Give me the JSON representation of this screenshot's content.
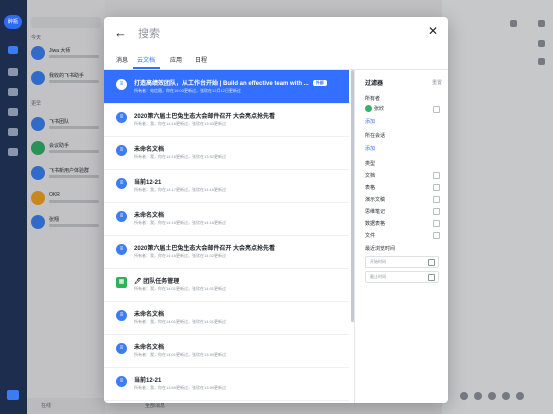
{
  "sidebar": {
    "avatar_label": "醉瓶"
  },
  "chat_list": {
    "search_placeholder": "搜索",
    "section_today": "今天",
    "section_earlier": "更早",
    "rows": [
      {
        "name": "Jiwa 大师"
      },
      {
        "name": "我收的飞书助手"
      },
      {
        "name": "飞书团队"
      },
      {
        "name": "会议助手"
      },
      {
        "name": "飞书新用户体验群"
      },
      {
        "name": "OKR"
      },
      {
        "name": "张翔"
      }
    ],
    "bottom_label": "在线"
  },
  "search_modal": {
    "back_icon": "arrow-left-icon",
    "close_icon": "close-icon",
    "placeholder": "搜索",
    "tabs": [
      {
        "label": "消息"
      },
      {
        "label": "云文档"
      },
      {
        "label": "应用"
      },
      {
        "label": "日程"
      }
    ],
    "active_tab": "云文档",
    "results": [
      {
        "title": "打造高绩效团队，从工作台开始 | Build an effective team with ...",
        "badge": "外部",
        "meta": "所有者：电信聂，你在16:03更新过，张欣在12月12日更新过",
        "icon": "doc-icon",
        "selected": true
      },
      {
        "title": "2020第六届土巴兔生态大会邮件召开 大会亮点抢先看",
        "meta": "所有者：我，你在14:16更新过，张欣在13:53更新过",
        "icon": "doc-icon"
      },
      {
        "title": "未命名文档",
        "meta": "所有者：我，你在14:16更新过，张欣在13:52更新过",
        "icon": "doc-icon"
      },
      {
        "title": "当前12-21",
        "meta": "所有者：我，你在14:17更新过，张欣在14:16更新过",
        "icon": "doc-icon"
      },
      {
        "title": "未命名文档",
        "meta": "所有者：我，你在14:16更新过，张欣在14:16更新过",
        "icon": "doc-icon"
      },
      {
        "title": "2020第六届土巴兔生态大会邮件召开 大会亮点抢先看",
        "meta": "所有者：我，你在14:16更新过，张欣在14:02更新过",
        "icon": "doc-icon"
      },
      {
        "title": "🖊 团队任务管理",
        "meta": "所有者：我，你在14:01更新过，张欣在14:01更新过",
        "icon": "sheet-icon",
        "green": true
      },
      {
        "title": "未命名文档",
        "meta": "所有者：我，你在14:01更新过，张欣在14:01更新过",
        "icon": "doc-icon"
      },
      {
        "title": "未命名文档",
        "meta": "所有者：我，你在14:01更新过，张欣在13:59更新过",
        "icon": "doc-icon"
      },
      {
        "title": "当前12-21",
        "meta": "所有者：我，你在13:59更新过，张欣在13:59更新过",
        "icon": "doc-icon"
      }
    ],
    "filter": {
      "title": "过滤器",
      "reset": "重置",
      "owner_heading": "所有者",
      "owner_name": "张欣",
      "owner_add": "添加",
      "chat_heading": "所在会话",
      "chat_add": "添加",
      "type_heading": "类型",
      "types": [
        {
          "label": "文档"
        },
        {
          "label": "表格"
        },
        {
          "label": "演示文稿"
        },
        {
          "label": "思维笔记"
        },
        {
          "label": "数据表格"
        },
        {
          "label": "文件"
        }
      ],
      "time_heading": "最近浏览时间",
      "start_placeholder": "开始时间",
      "end_placeholder": "截止时间"
    }
  },
  "bottom_bar": {
    "label": "全部消息"
  }
}
